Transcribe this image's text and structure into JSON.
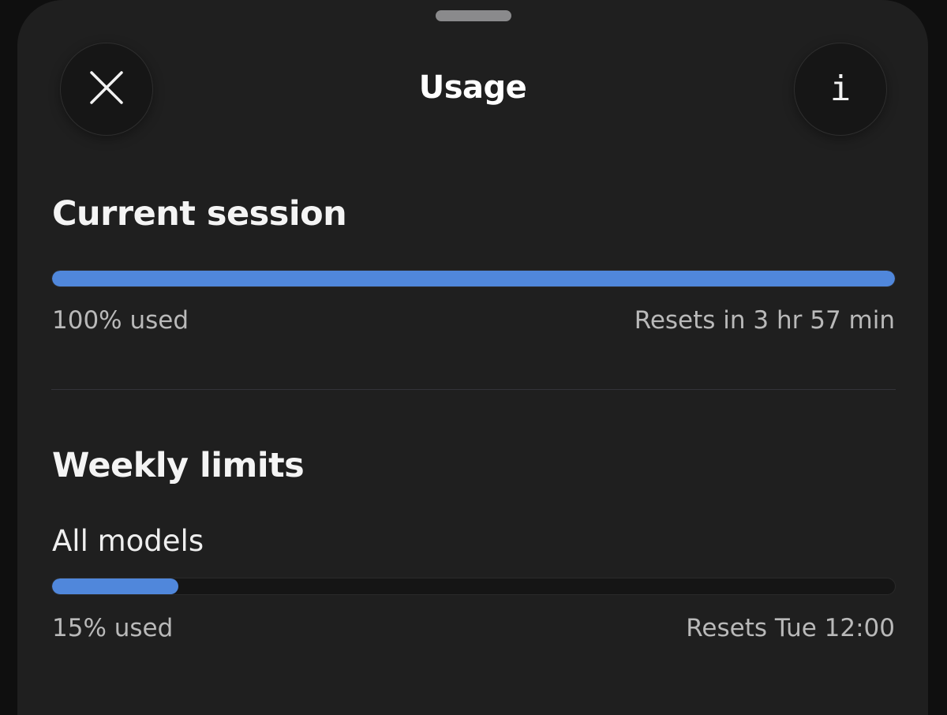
{
  "header": {
    "title": "Usage",
    "close_icon": "close-icon",
    "info_icon": "info-icon",
    "info_glyph": "i"
  },
  "current_session": {
    "heading": "Current session",
    "progress_percent": 100,
    "used_label": "100% used",
    "reset_label": "Resets in 3 hr 57 min"
  },
  "weekly_limits": {
    "heading": "Weekly limits",
    "all_models": {
      "label": "All models",
      "progress_percent": 15,
      "used_label": "15% used",
      "reset_label": "Resets Tue 12:00"
    }
  },
  "colors": {
    "accent": "#5087db",
    "background": "#1f1f1f"
  }
}
